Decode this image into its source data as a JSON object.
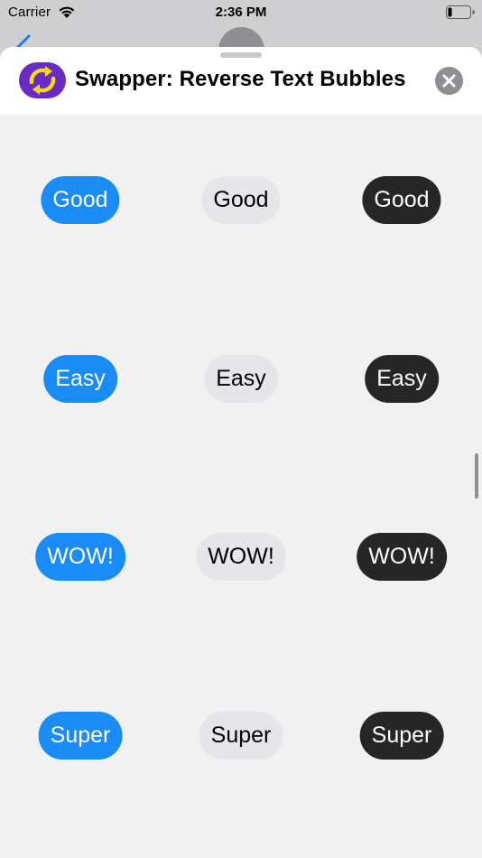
{
  "status_bar": {
    "carrier": "Carrier",
    "time": "2:36 PM"
  },
  "header": {
    "title": "Swapper: Reverse Text Bubbles",
    "app_icon": "swap-arrows-icon",
    "close_icon": "close-icon"
  },
  "colors": {
    "blue_bubble": "#1a8cf8",
    "gray_bubble": "#e5e5ea",
    "dark_bubble": "#262626",
    "app_icon_purple": "#6a2bc4",
    "app_icon_yellow": "#f5d816"
  },
  "stickers": {
    "rows": [
      {
        "blue": "Good",
        "gray": "Good",
        "dark": "Good"
      },
      {
        "blue": "Easy",
        "gray": "Easy",
        "dark": "Easy"
      },
      {
        "blue": "WOW!",
        "gray": "WOW!",
        "dark": "WOW!"
      },
      {
        "blue": "Super",
        "gray": "Super",
        "dark": "Super"
      }
    ]
  }
}
